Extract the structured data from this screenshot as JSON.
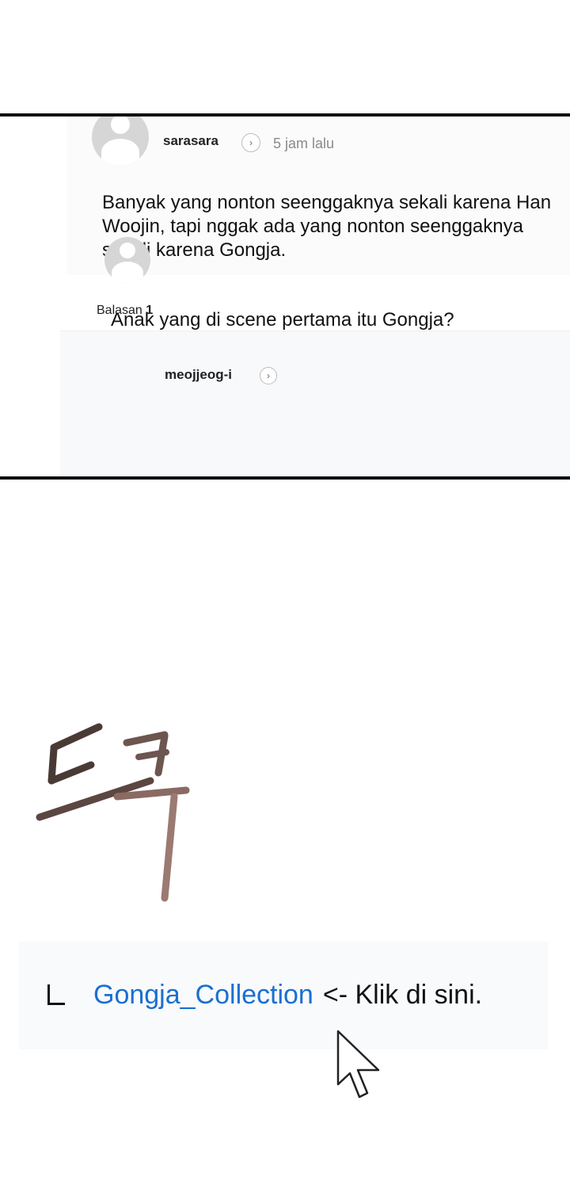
{
  "comment": {
    "username": "sarasara",
    "timestamp": "5 jam lalu",
    "text": "Banyak yang nonton seenggaknya sekali karena Han Woojin, tapi nggak ada yang nonton seenggaknya sekali karena Gongja.",
    "replies_label": "Balasan",
    "replies_count": "1"
  },
  "reply": {
    "username": "meojjeog-i",
    "text": "Anak yang di scene pertama itu Gongja?"
  },
  "sfx": {
    "icon": "korean-sound-effect-drawing"
  },
  "footer": {
    "link_text": "Gongja_Collection",
    "suffix": "<- Klik di sini."
  },
  "colors": {
    "link": "#1a6fd1",
    "timestamp": "#8a8a8a",
    "border": "#111111"
  }
}
